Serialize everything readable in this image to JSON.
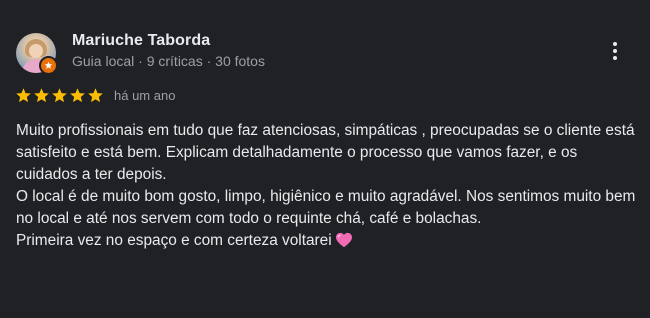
{
  "reviewer": {
    "name": "Mariuche Taborda",
    "meta": "Guia local · 9 críticas · 30 fotos"
  },
  "review": {
    "rating": 5,
    "rating_max": 5,
    "time": "há um ano",
    "paragraphs": [
      "Muito profissionais em tudo que faz atenciosas, simpáticas , preocupadas se o cliente está satisfeito e está bem. Explicam detalhadamente o processo que vamos fazer, e os cuidados a ter depois.",
      "O local é de muito bom gosto, limpo, higiênico e muito agradável. Nos sentimos muito bem no local e até nos servem com todo o requinte chá, café e bolachas.",
      "Primeira vez no espaço e com certeza voltarei"
    ]
  },
  "icons": {
    "star": "star-icon",
    "badge": "local-guide-badge-icon",
    "menu": "more-vert-icon",
    "heart": "pink-heart-icon"
  },
  "colors": {
    "background": "#202124",
    "text": "#e8eaed",
    "muted": "#9aa0a6",
    "star": "#fbbc04",
    "badge": "#e8710a",
    "heart": "#f06bb4"
  }
}
